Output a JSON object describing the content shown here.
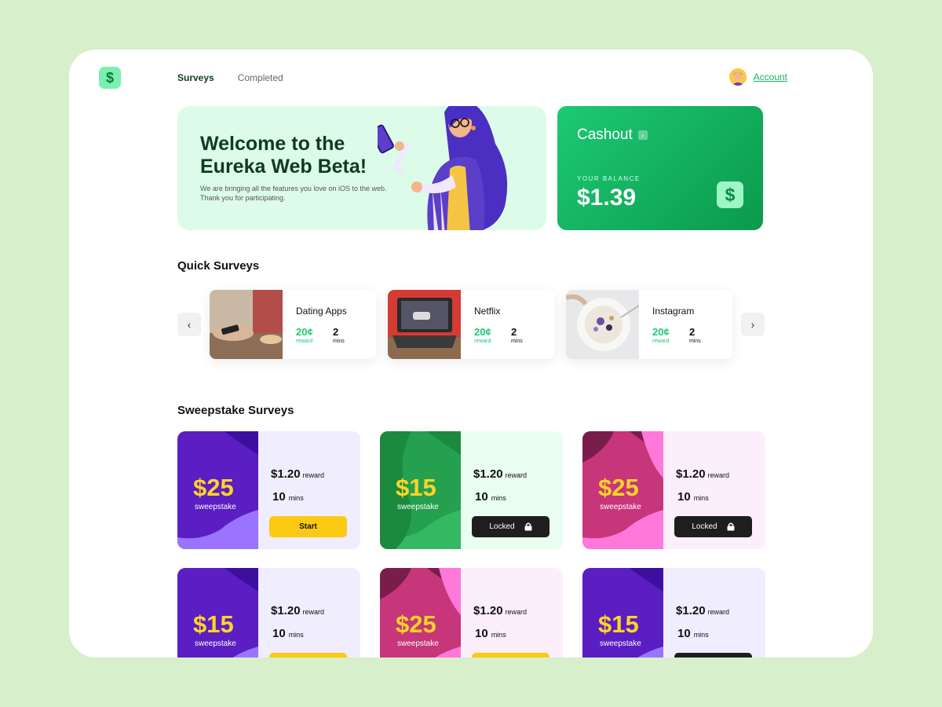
{
  "nav": {
    "tabs": [
      {
        "label": "Surveys"
      },
      {
        "label": "Completed"
      }
    ],
    "account_label": "Account"
  },
  "hero": {
    "title": "Welcome to the Eureka Web Beta!",
    "text": "We are bringing all the features you love on iOS to the web. Thank you for participating."
  },
  "cashout": {
    "title": "Cashout",
    "balance_label": "YOUR BALANCE",
    "balance": "$1.39"
  },
  "quick": {
    "title": "Quick Surveys",
    "reward_label": "reward",
    "mins_label": "mins",
    "items": [
      {
        "name": "Dating Apps",
        "reward": "20¢",
        "mins": "2"
      },
      {
        "name": "Netflix",
        "reward": "20¢",
        "mins": "2"
      },
      {
        "name": "Instagram",
        "reward": "20¢",
        "mins": "2"
      }
    ]
  },
  "sweep": {
    "title": "Sweepstake Surveys",
    "sweep_label": "sweepstake",
    "reward_unit": "reward",
    "mins_unit": "mins",
    "items": [
      {
        "amount": "$25",
        "reward": "$1.20",
        "mins": "10",
        "button": "Start",
        "state": "start",
        "theme": "purple"
      },
      {
        "amount": "$15",
        "reward": "$1.20",
        "mins": "10",
        "button": "Locked",
        "state": "locked",
        "theme": "green"
      },
      {
        "amount": "$25",
        "reward": "$1.20",
        "mins": "10",
        "button": "Locked",
        "state": "locked",
        "theme": "pink"
      },
      {
        "amount": "$15",
        "reward": "$1.20",
        "mins": "10",
        "button": "",
        "state": "start",
        "theme": "purple"
      },
      {
        "amount": "$25",
        "reward": "$1.20",
        "mins": "10",
        "button": "",
        "state": "start",
        "theme": "pink"
      },
      {
        "amount": "$15",
        "reward": "$1.20",
        "mins": "10",
        "button": "",
        "state": "locked",
        "theme": "purple"
      }
    ]
  },
  "colors": {
    "accent": "#1dc974",
    "bg": "#d7efcb",
    "yellow": "#fcca12"
  }
}
